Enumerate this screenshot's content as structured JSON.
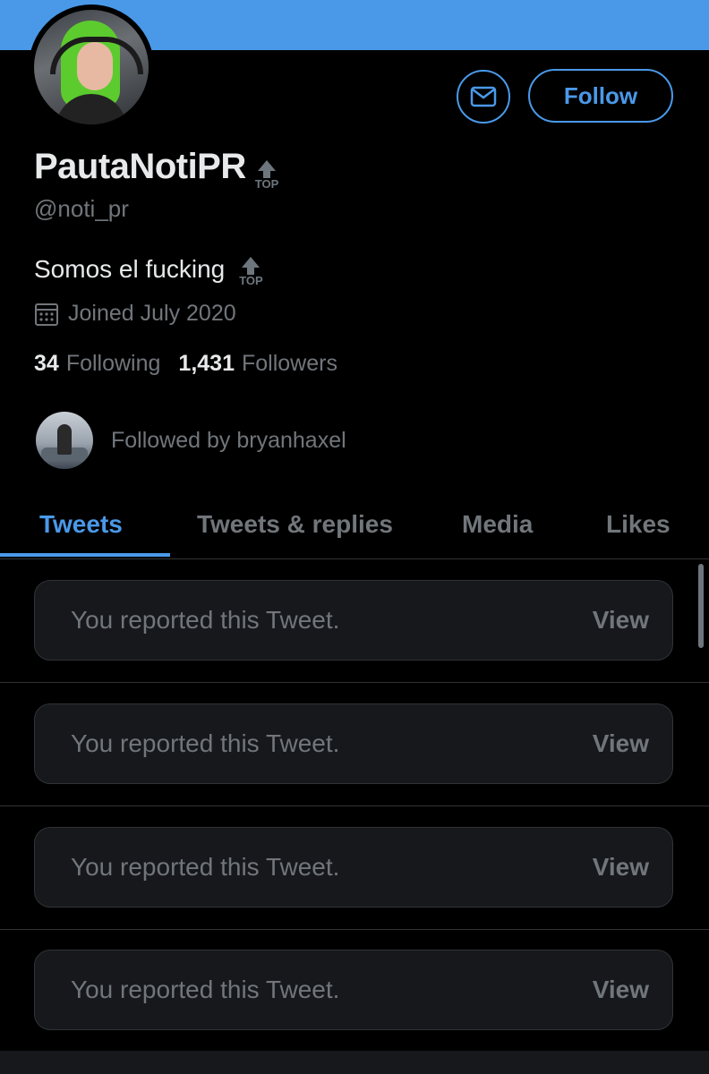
{
  "theme": {
    "accent": "#4a99e9",
    "banner_color": "#4a99e9",
    "background": "#000000"
  },
  "profile": {
    "display_name": "PautaNotiPR",
    "name_badge": "TOP",
    "handle": "@noti_pr",
    "bio": "Somos el fucking",
    "bio_badge": "TOP",
    "joined": "Joined July 2020",
    "following_count": "34",
    "following_label": "Following",
    "followers_count": "1,431",
    "followers_label": "Followers",
    "followed_by": "Followed by bryanhaxel"
  },
  "actions": {
    "follow_label": "Follow",
    "message_icon": "mail-icon"
  },
  "tabs": [
    {
      "label": "Tweets",
      "active": true
    },
    {
      "label": "Tweets & replies",
      "active": false
    },
    {
      "label": "Media",
      "active": false
    },
    {
      "label": "Likes",
      "active": false
    }
  ],
  "timeline": [
    {
      "text": "You reported this Tweet.",
      "action": "View"
    },
    {
      "text": "You reported this Tweet.",
      "action": "View"
    },
    {
      "text": "You reported this Tweet.",
      "action": "View"
    },
    {
      "text": "You reported this Tweet.",
      "action": "View"
    }
  ]
}
